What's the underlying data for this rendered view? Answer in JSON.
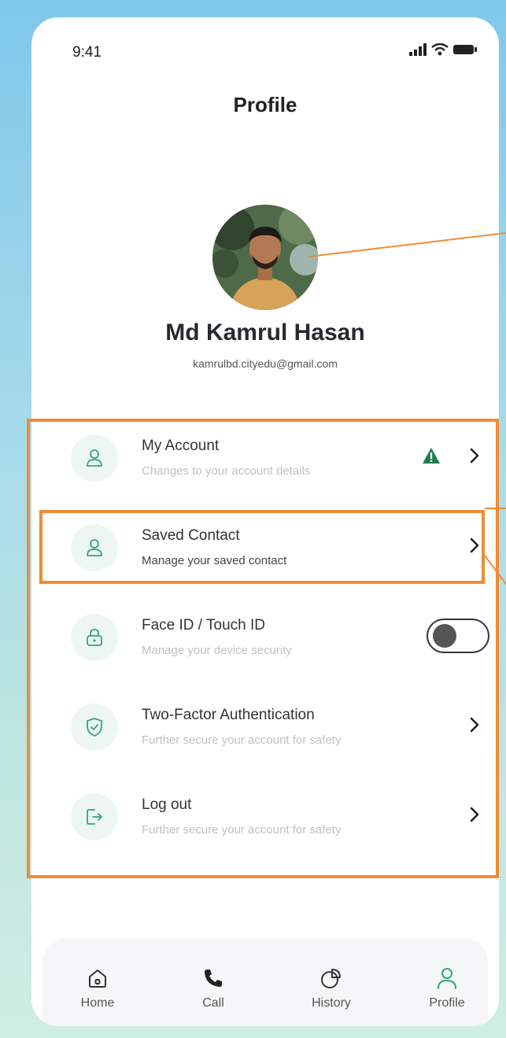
{
  "status_bar": {
    "time": "9:41"
  },
  "header": {
    "title": "Profile"
  },
  "profile": {
    "name": "Md Kamrul Hasan",
    "email": "kamrulbd.cityedu@gmail.com"
  },
  "menu": [
    {
      "title": "My Account",
      "subtitle": "Changes to your account details",
      "icon": "user-icon",
      "trailing": "chevron",
      "warning": true
    },
    {
      "title": "Saved Contact",
      "subtitle": "Manage your saved contact",
      "icon": "user-icon",
      "trailing": "chevron"
    },
    {
      "title": "Face ID / Touch ID",
      "subtitle": "Manage your device security",
      "icon": "lock-icon",
      "trailing": "toggle",
      "toggle_on": false
    },
    {
      "title": "Two-Factor Authentication",
      "subtitle": "Further secure your account for safety",
      "icon": "shield-icon",
      "trailing": "chevron"
    },
    {
      "title": "Log out",
      "subtitle": "Further secure your account for safety",
      "icon": "logout-icon",
      "trailing": "chevron"
    }
  ],
  "bottom_nav": [
    {
      "label": "Home",
      "icon": "home-icon",
      "active": false
    },
    {
      "label": "Call",
      "icon": "phone-icon",
      "active": false
    },
    {
      "label": "History",
      "icon": "history-icon",
      "active": false
    },
    {
      "label": "Profile",
      "icon": "profile-icon",
      "active": true
    }
  ],
  "colors": {
    "accent": "#2fa874",
    "warning": "#1f7a4a",
    "annotation": "#f08c36"
  }
}
